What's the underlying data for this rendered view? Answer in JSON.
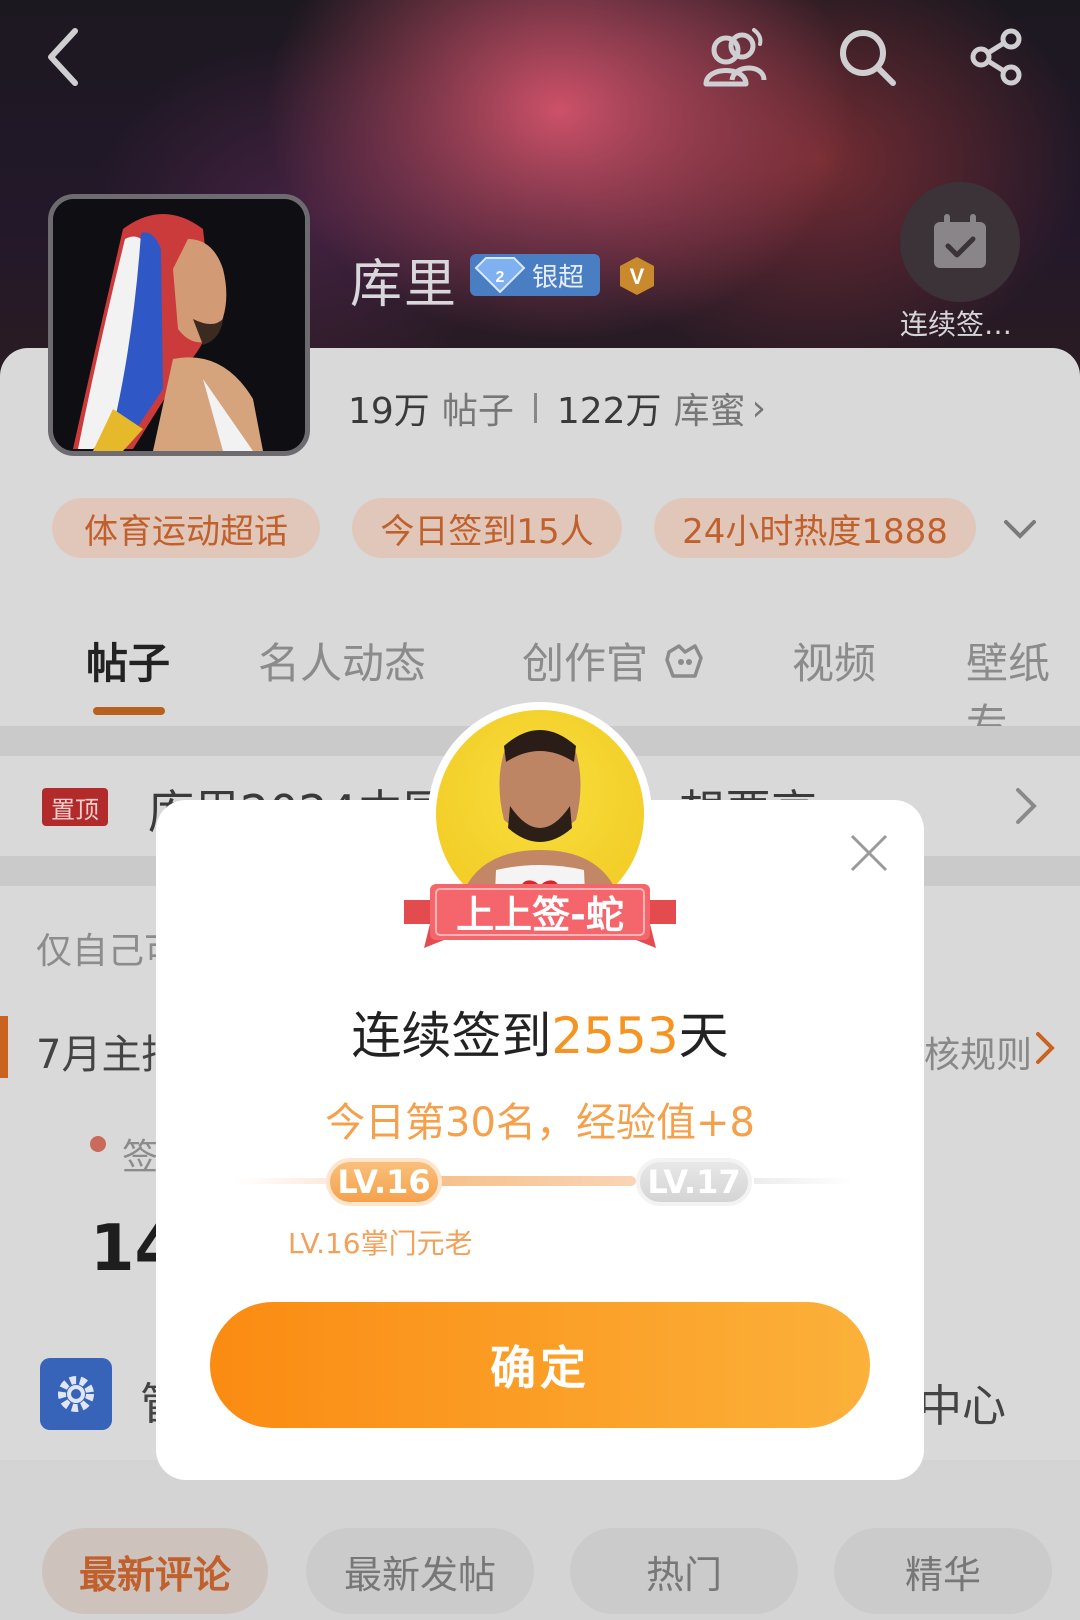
{
  "header": {
    "name": "库里",
    "badge_label": "银超",
    "checkin_label": "连续签…"
  },
  "stats": {
    "posts_count": "19万",
    "posts_label": "帖子",
    "fans_count": "122万",
    "fans_label": "库蜜",
    "fans_chevron": "›"
  },
  "chips": [
    "体育运动超话",
    "今日签到15人",
    "24小时热度1888"
  ],
  "tabs": [
    {
      "label": "帖子",
      "active": true
    },
    {
      "label": "名人动态",
      "active": false
    },
    {
      "label": "创作官",
      "active": false
    },
    {
      "label": "视频",
      "active": false
    },
    {
      "label": "壁纸专",
      "active": false
    }
  ],
  "pinned": {
    "tag": "置顶",
    "title": "库里2024中国…………，想要高…"
  },
  "feed": {
    "self_visible": "仅自己可",
    "july_text": "7月主持",
    "rule_link": "核规则",
    "dot_text": "签",
    "big_number": "14,",
    "manager_text": "管",
    "center_text": "中心"
  },
  "bottom_tabs": [
    {
      "label": "最新评论",
      "active": true
    },
    {
      "label": "最新发帖",
      "active": false
    },
    {
      "label": "热门",
      "active": false
    },
    {
      "label": "精华",
      "active": false
    }
  ],
  "modal": {
    "ribbon": "上上签-蛇",
    "title_prefix": "连续签到",
    "title_days": "2553",
    "title_suffix": "天",
    "subtitle": "今日第30名，经验值+8",
    "level_current": "LV.16",
    "level_next": "LV.17",
    "level_name": "LV.16掌门元老",
    "confirm": "确定",
    "level_progress": 0.0
  },
  "colors": {
    "accent_orange": "#f59422",
    "chip_text": "#c0602d",
    "pin_tag": "#b22a2a"
  }
}
